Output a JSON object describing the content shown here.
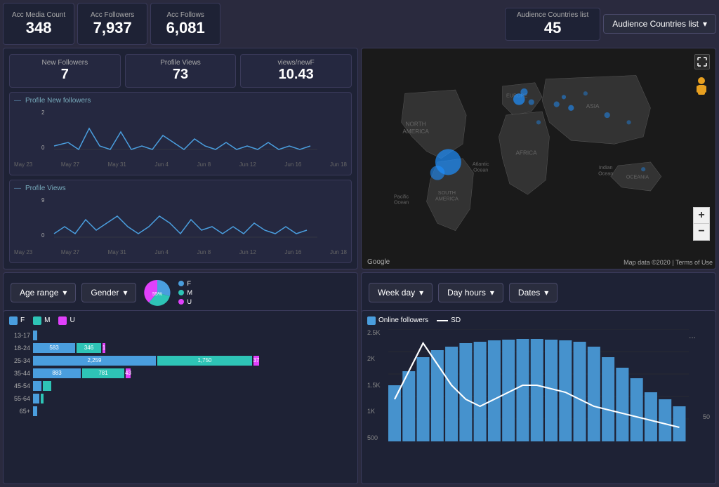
{
  "topStats": {
    "accMediaCount": {
      "label": "Acc Media Count",
      "value": "348"
    },
    "accFollowers": {
      "label": "Acc Followers",
      "value": "7,937"
    },
    "accFollows": {
      "label": "Acc Follows",
      "value": "6,081"
    },
    "audienceCountries": {
      "label": "Audience Countries list",
      "value": "45"
    },
    "audienceDropdown": "Audience Countries list"
  },
  "leftPanel": {
    "newFollowers": {
      "label": "New Followers",
      "value": "7"
    },
    "profileViews": {
      "label": "Profile Views",
      "value": "73"
    },
    "viewsPerNewF": {
      "label": "views/newF",
      "value": "10.43"
    },
    "chart1Title": "Profile New followers",
    "chart2Title": "Profile Views"
  },
  "filterBar": {
    "left": {
      "ageRange": "Age range",
      "gender": "Gender"
    },
    "right": {
      "weekDay": "Week day",
      "dayHours": "Day hours",
      "dates": "Dates"
    },
    "piePercent": "55%",
    "legendF": "F",
    "legendM": "M",
    "legendU": "U"
  },
  "barChart": {
    "legendF": "F",
    "legendM": "M",
    "legendU": "U",
    "ageGroups": [
      {
        "label": "13-17",
        "f": 4,
        "fLabel": "",
        "m": 0,
        "mLabel": "",
        "u": 0,
        "uLabel": ""
      },
      {
        "label": "18-24",
        "f": 583,
        "fLabel": "583",
        "m": 346,
        "mLabel": "346",
        "u": 1,
        "uLabel": "1"
      },
      {
        "label": "25-34",
        "f": 2259,
        "fLabel": "2,259",
        "m": 1750,
        "mLabel": "1,750",
        "u": 37,
        "uLabel": "37"
      },
      {
        "label": "35-44",
        "f": 883,
        "fLabel": "883",
        "m": 781,
        "mLabel": "781",
        "u": 43,
        "uLabel": "43"
      },
      {
        "label": "45-54",
        "f": 111,
        "fLabel": "",
        "m": 116,
        "mLabel": "",
        "u": 0,
        "uLabel": ""
      },
      {
        "label": "55-64",
        "f": 60,
        "fLabel": "",
        "m": 5,
        "mLabel": "",
        "u": 0,
        "uLabel": ""
      },
      {
        "label": "65+",
        "f": 36,
        "fLabel": "",
        "m": 3,
        "mLabel": "",
        "u": 0,
        "uLabel": ""
      }
    ]
  },
  "lineChart": {
    "title": "Online followers",
    "sdLabel": "SD",
    "yLabels": [
      "2.5K",
      "2K",
      "1.5K",
      "1K",
      "500"
    ],
    "lastValue": "50",
    "dotsMenuLabel": "..."
  },
  "map": {
    "googleLabel": "Google",
    "mapDataLabel": "Map data ©2020",
    "termsLabel": "Terms of Use"
  }
}
